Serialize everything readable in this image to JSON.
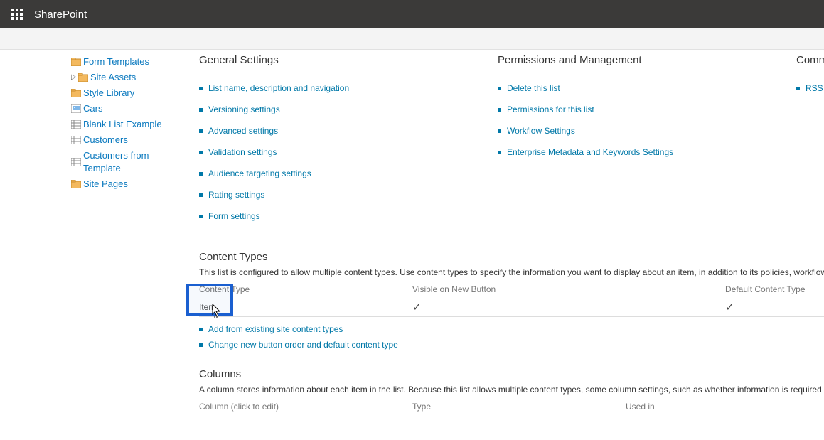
{
  "suite": {
    "title": "SharePoint"
  },
  "sidebar": {
    "items": [
      {
        "label": "Form Templates",
        "icon": "folder"
      },
      {
        "label": "Site Assets",
        "icon": "folder",
        "expandable": true
      },
      {
        "label": "Style Library",
        "icon": "folder"
      },
      {
        "label": "Cars",
        "icon": "image-list"
      },
      {
        "label": "Blank List Example",
        "icon": "list"
      },
      {
        "label": "Customers",
        "icon": "list"
      },
      {
        "label": "Customers from Template",
        "icon": "list"
      },
      {
        "label": "Site Pages",
        "icon": "folder"
      }
    ]
  },
  "settings": {
    "col1": {
      "title": "General Settings",
      "links": [
        "List name, description and navigation",
        "Versioning settings",
        "Advanced settings",
        "Validation settings",
        "Audience targeting settings",
        "Rating settings",
        "Form settings"
      ]
    },
    "col2": {
      "title": "Permissions and Management",
      "links": [
        "Delete this list",
        "Permissions for this list",
        "Workflow Settings",
        "Enterprise Metadata and Keywords Settings"
      ]
    },
    "col3": {
      "title": "Communications",
      "links": [
        "RSS settings"
      ]
    }
  },
  "content_types": {
    "title": "Content Types",
    "desc": "This list is configured to allow multiple content types. Use content types to specify the information you want to display about an item, in addition to its policies, workflows, or other behavior. The following content types are currently available in this list:",
    "headers": {
      "c1": "Content Type",
      "c2": "Visible on New Button",
      "c3": "Default Content Type"
    },
    "rows": [
      {
        "name": "Item",
        "visible": "✓",
        "default": "✓"
      }
    ],
    "actions": [
      "Add from existing site content types",
      "Change new button order and default content type"
    ]
  },
  "columns": {
    "title": "Columns",
    "desc": "A column stores information about each item in the list. Because this list allows multiple content types, some column settings, such as whether information is required or optional for a column, are now specified by the content type of the item.",
    "headers": {
      "c1": "Column (click to edit)",
      "c2": "Type",
      "c3": "Used in"
    }
  }
}
